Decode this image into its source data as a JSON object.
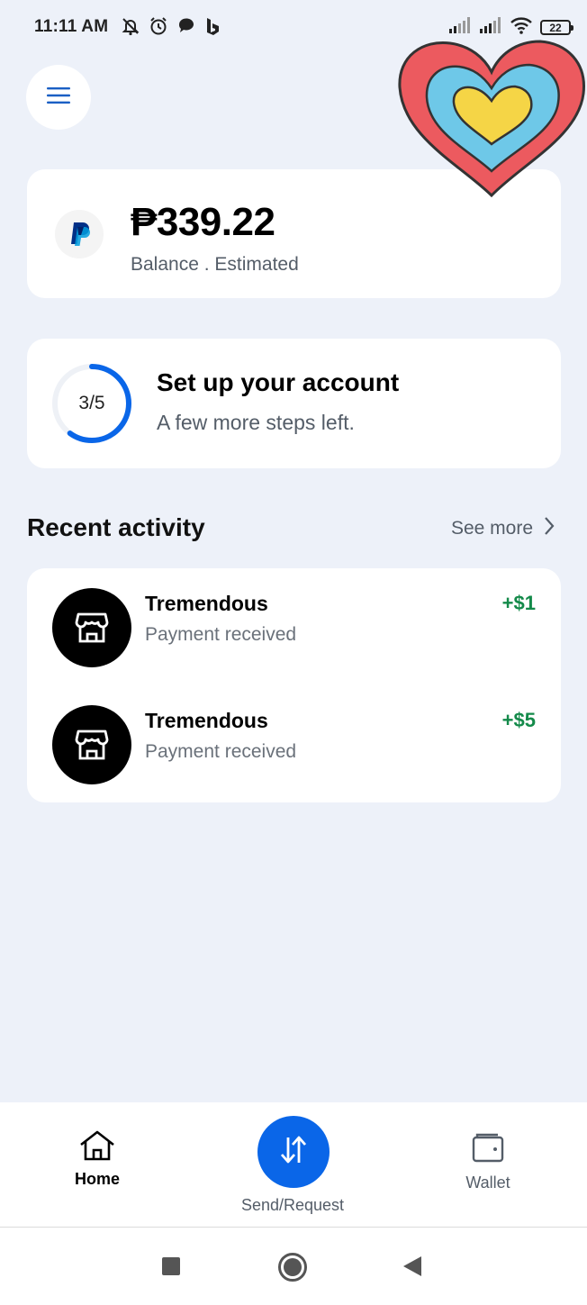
{
  "status_bar": {
    "time": "11:11 AM",
    "battery": "22",
    "icons_left": [
      "mute-bell-icon",
      "alarm-icon",
      "chat-bubble-icon",
      "bing-icon"
    ],
    "icons_right": [
      "signal-icon",
      "signal-icon",
      "wifi-icon",
      "battery-icon"
    ]
  },
  "header": {
    "menu_icon": "hamburger-menu-icon",
    "sticker": "heart-sticker"
  },
  "balance": {
    "amount": "₱339.22",
    "label": "Balance . Estimated",
    "logo": "paypal-logo"
  },
  "setup": {
    "progress_text": "3/5",
    "progress_value": 0.6,
    "title": "Set up your account",
    "subtitle": "A few more steps left."
  },
  "recent": {
    "title": "Recent activity",
    "see_more": "See more",
    "items": [
      {
        "name": "Tremendous",
        "desc": "Payment received",
        "amount": "+$1",
        "icon": "storefront-icon"
      },
      {
        "name": "Tremendous",
        "desc": "Payment received",
        "amount": "+$5",
        "icon": "storefront-icon"
      }
    ]
  },
  "bottom_nav": {
    "home": "Home",
    "send_request": "Send/Request",
    "wallet": "Wallet"
  },
  "colors": {
    "background": "#edf1f9",
    "primary_blue": "#0a66e8",
    "positive_green": "#148a4a",
    "muted_text": "#545d68"
  }
}
